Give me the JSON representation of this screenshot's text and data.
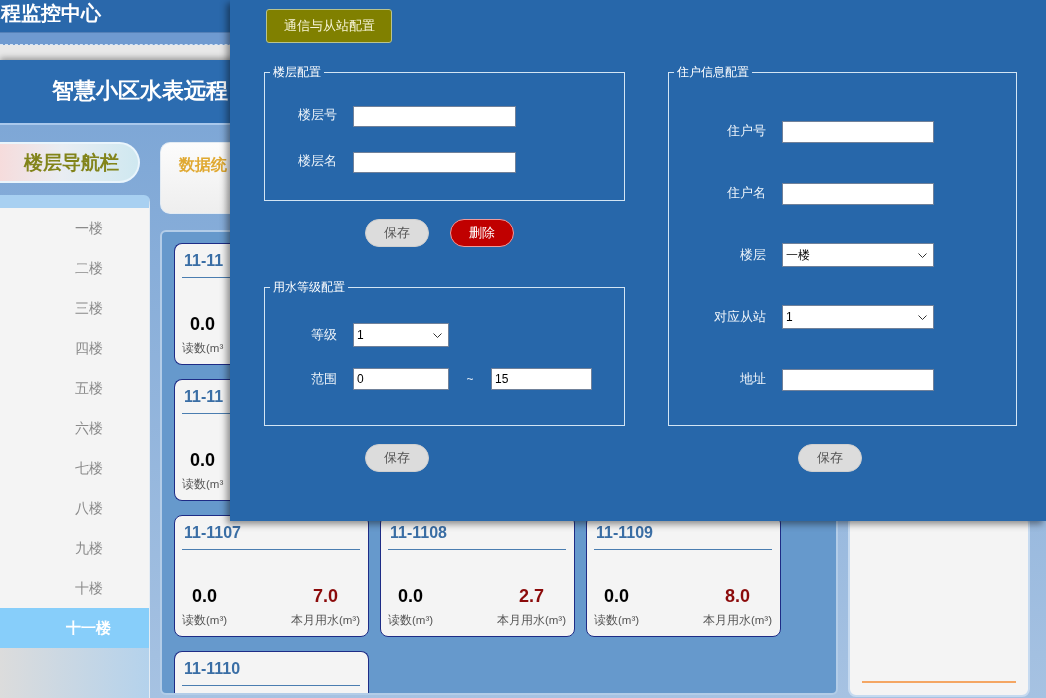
{
  "back_window": {
    "title": "程监控中心"
  },
  "main_window": {
    "title": "智慧小区水表远程",
    "nav_title": "楼层导航栏",
    "floors": [
      {
        "label": "一楼",
        "selected": false
      },
      {
        "label": "二楼",
        "selected": false
      },
      {
        "label": "三楼",
        "selected": false
      },
      {
        "label": "四楼",
        "selected": false
      },
      {
        "label": "五楼",
        "selected": false
      },
      {
        "label": "六楼",
        "selected": false
      },
      {
        "label": "七楼",
        "selected": false
      },
      {
        "label": "八楼",
        "selected": false
      },
      {
        "label": "九楼",
        "selected": false
      },
      {
        "label": "十楼",
        "selected": false
      },
      {
        "label": "十一楼",
        "selected": true
      }
    ],
    "stats_title": "数据统",
    "meters": [
      {
        "kind": "covered",
        "room": "11-11",
        "reading": "0.0",
        "reading_label": "读数(m³"
      },
      {
        "kind": "covered",
        "room": "11-11",
        "reading": "0.0",
        "reading_label": "读数(m³"
      },
      {
        "kind": "full",
        "room": "11-1107",
        "reading": "0.0",
        "reading_label": "读数(m³)",
        "usage": "7.0",
        "usage_label": "本月用水(m³)"
      },
      {
        "kind": "full",
        "room": "11-1108",
        "reading": "0.0",
        "reading_label": "读数(m³)",
        "usage": "2.7",
        "usage_label": "本月用水(m³)"
      },
      {
        "kind": "full",
        "room": "11-1109",
        "reading": "0.0",
        "reading_label": "读数(m³)",
        "usage": "8.0",
        "usage_label": "本月用水(m³)"
      },
      {
        "kind": "clipped",
        "room": "11-1110"
      }
    ]
  },
  "dialog": {
    "button": {
      "label": "通信与从站配置"
    },
    "columns": [
      {
        "groups": [
          {
            "title": "楼层配置",
            "fields": [
              {
                "kind": "text",
                "label": "楼层号"
              },
              {
                "kind": "text",
                "label": "楼层名"
              }
            ],
            "buttons": [
              {
                "kind": "save",
                "label": "保存"
              },
              {
                "kind": "delete",
                "label": "删除"
              }
            ]
          },
          {
            "title": "用水等级配置",
            "fields": [
              {
                "kind": "select",
                "label": "等级",
                "value": "1"
              },
              {
                "kind": "range",
                "label": "范围",
                "from": "0",
                "separator": "~",
                "to": "15"
              }
            ],
            "buttons": [
              {
                "kind": "save",
                "label": "保存"
              }
            ]
          }
        ]
      },
      {
        "groups": [
          {
            "title": "住户信息配置",
            "fields": [
              {
                "kind": "text",
                "label": "住户号"
              },
              {
                "kind": "text",
                "label": "住户名"
              },
              {
                "kind": "select",
                "label": "楼层",
                "value": "一楼"
              },
              {
                "kind": "select",
                "label": "对应从站",
                "value": "1"
              },
              {
                "kind": "text",
                "label": "地址"
              }
            ],
            "buttons": [
              {
                "kind": "save",
                "label": "保存"
              }
            ]
          }
        ]
      }
    ]
  }
}
